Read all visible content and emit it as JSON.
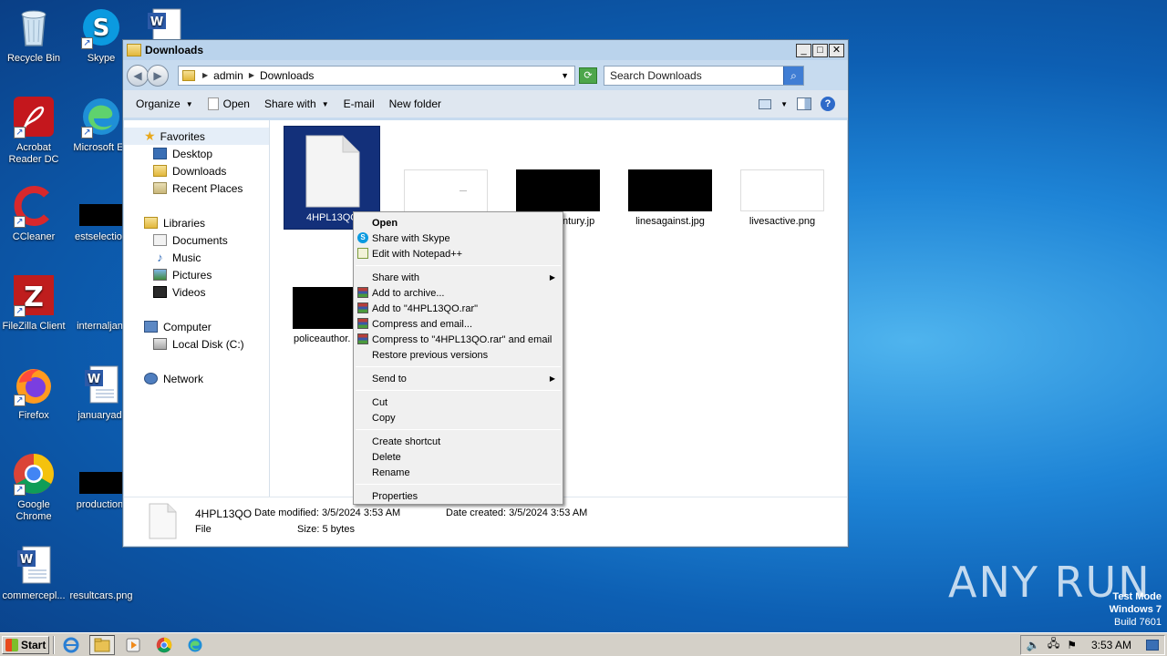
{
  "desktop": {
    "icons": [
      {
        "label": "Recycle Bin",
        "icon": "recycle-bin-icon"
      },
      {
        "label": "Skype",
        "icon": "skype-icon"
      },
      {
        "label": "Acrobat Reader DC",
        "icon": "acrobat-icon"
      },
      {
        "label": "Microsoft Ed",
        "icon": "edge-icon"
      },
      {
        "label": "CCleaner",
        "icon": "ccleaner-icon"
      },
      {
        "label": "estselection",
        "icon": "image-file-icon"
      },
      {
        "label": "FileZilla Client",
        "icon": "filezilla-icon"
      },
      {
        "label": "internaljan.",
        "icon": "file-icon"
      },
      {
        "label": "Firefox",
        "icon": "firefox-icon"
      },
      {
        "label": "januaryad.",
        "icon": "word-doc-icon"
      },
      {
        "label": "Google Chrome",
        "icon": "chrome-icon"
      },
      {
        "label": "production.",
        "icon": "image-file-icon"
      },
      {
        "label": "commercepl...",
        "icon": "word-doc-icon"
      },
      {
        "label": "resultcars.png",
        "icon": "image-file-icon"
      }
    ]
  },
  "window": {
    "title": "Downloads",
    "address": {
      "segments": [
        "admin",
        "Downloads"
      ]
    },
    "search_placeholder": "Search Downloads",
    "toolbar": {
      "organize": "Organize",
      "open": "Open",
      "share_with": "Share with",
      "email": "E-mail",
      "new_folder": "New folder"
    },
    "nav": {
      "favorites": "Favorites",
      "desktop": "Desktop",
      "downloads": "Downloads",
      "recent_places": "Recent Places",
      "libraries": "Libraries",
      "documents": "Documents",
      "music": "Music",
      "pictures": "Pictures",
      "videos": "Videos",
      "computer": "Computer",
      "local_disk": "Local Disk (C:)",
      "network": "Network"
    },
    "files": [
      {
        "name": "4HPL13QO",
        "selected": true
      },
      {
        "name": "",
        "selected": false
      },
      {
        "name": "...ntury.jp",
        "selected": false
      },
      {
        "name": "linesagainst.jpg",
        "selected": false
      },
      {
        "name": "livesactive.png",
        "selected": false
      },
      {
        "name": "policeauthor.",
        "selected": false
      }
    ],
    "status": {
      "name": "4HPL13QO",
      "date_modified": "Date modified: 3/5/2024 3:53 AM",
      "date_created": "Date created: 3/5/2024 3:53 AM",
      "type": "File",
      "size": "Size: 5 bytes"
    }
  },
  "context_menu": {
    "open": "Open",
    "share_skype": "Share with Skype",
    "edit_notepad": "Edit with Notepad++",
    "share_with": "Share with",
    "add_archive": "Add to archive...",
    "add_rar": "Add to \"4HPL13QO.rar\"",
    "compress_email": "Compress and email...",
    "compress_rar_email": "Compress to \"4HPL13QO.rar\" and email",
    "restore": "Restore previous versions",
    "send_to": "Send to",
    "cut": "Cut",
    "copy": "Copy",
    "create_shortcut": "Create shortcut",
    "delete": "Delete",
    "rename": "Rename",
    "properties": "Properties"
  },
  "taskbar": {
    "start": "Start",
    "clock": "3:53 AM"
  },
  "watermark": {
    "brand": "ANY RUN",
    "line1": "Test Mode",
    "line2": "Windows 7",
    "line3": "Build 7601"
  }
}
